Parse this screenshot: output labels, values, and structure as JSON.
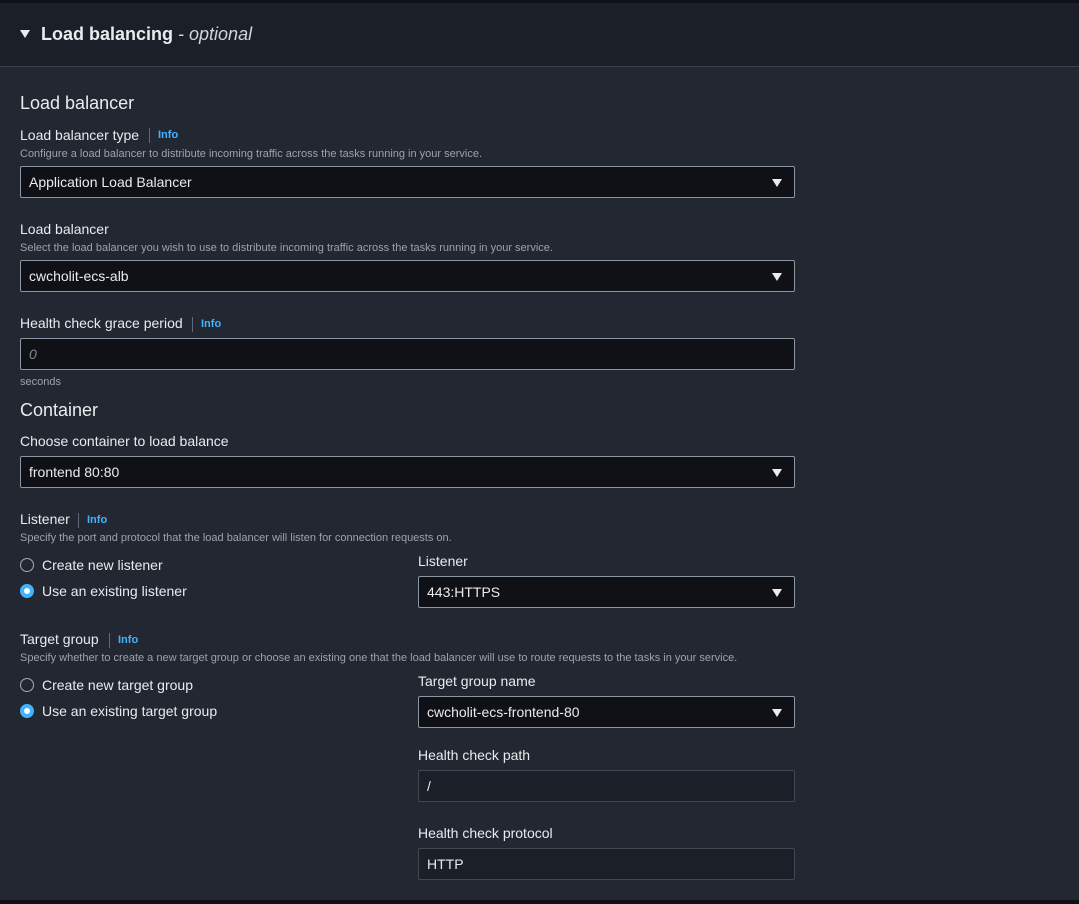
{
  "section": {
    "title": "Load balancing",
    "optional": "- optional"
  },
  "load_balancer": {
    "heading": "Load balancer",
    "type": {
      "label": "Load balancer type",
      "info": "Info",
      "description": "Configure a load balancer to distribute incoming traffic across the tasks running in your service.",
      "value": "Application Load Balancer"
    },
    "lb": {
      "label": "Load balancer",
      "description": "Select the load balancer you wish to use to distribute incoming traffic across the tasks running in your service.",
      "value": "cwcholit-ecs-alb"
    },
    "grace": {
      "label": "Health check grace period",
      "info": "Info",
      "placeholder": "0",
      "unit": "seconds"
    }
  },
  "container": {
    "heading": "Container",
    "choose": {
      "label": "Choose container to load balance",
      "value": "frontend 80:80"
    },
    "listener": {
      "label": "Listener",
      "info": "Info",
      "description": "Specify the port and protocol that the load balancer will listen for connection requests on.",
      "options": [
        "Create new listener",
        "Use an existing listener"
      ],
      "selected": "Use an existing listener",
      "select_label": "Listener",
      "select_value": "443:HTTPS"
    },
    "target_group": {
      "label": "Target group",
      "info": "Info",
      "description": "Specify whether to create a new target group or choose an existing one that the load balancer will use to route requests to the tasks in your service.",
      "options": [
        "Create new target group",
        "Use an existing target group"
      ],
      "selected": "Use an existing target group",
      "name_label": "Target group name",
      "name_value": "cwcholit-ecs-frontend-80",
      "path_label": "Health check path",
      "path_value": "/",
      "protocol_label": "Health check protocol",
      "protocol_value": "HTTP"
    }
  },
  "colors": {
    "accent": "#42b4ff",
    "background": "#232731",
    "input_bg": "#0f1117"
  }
}
